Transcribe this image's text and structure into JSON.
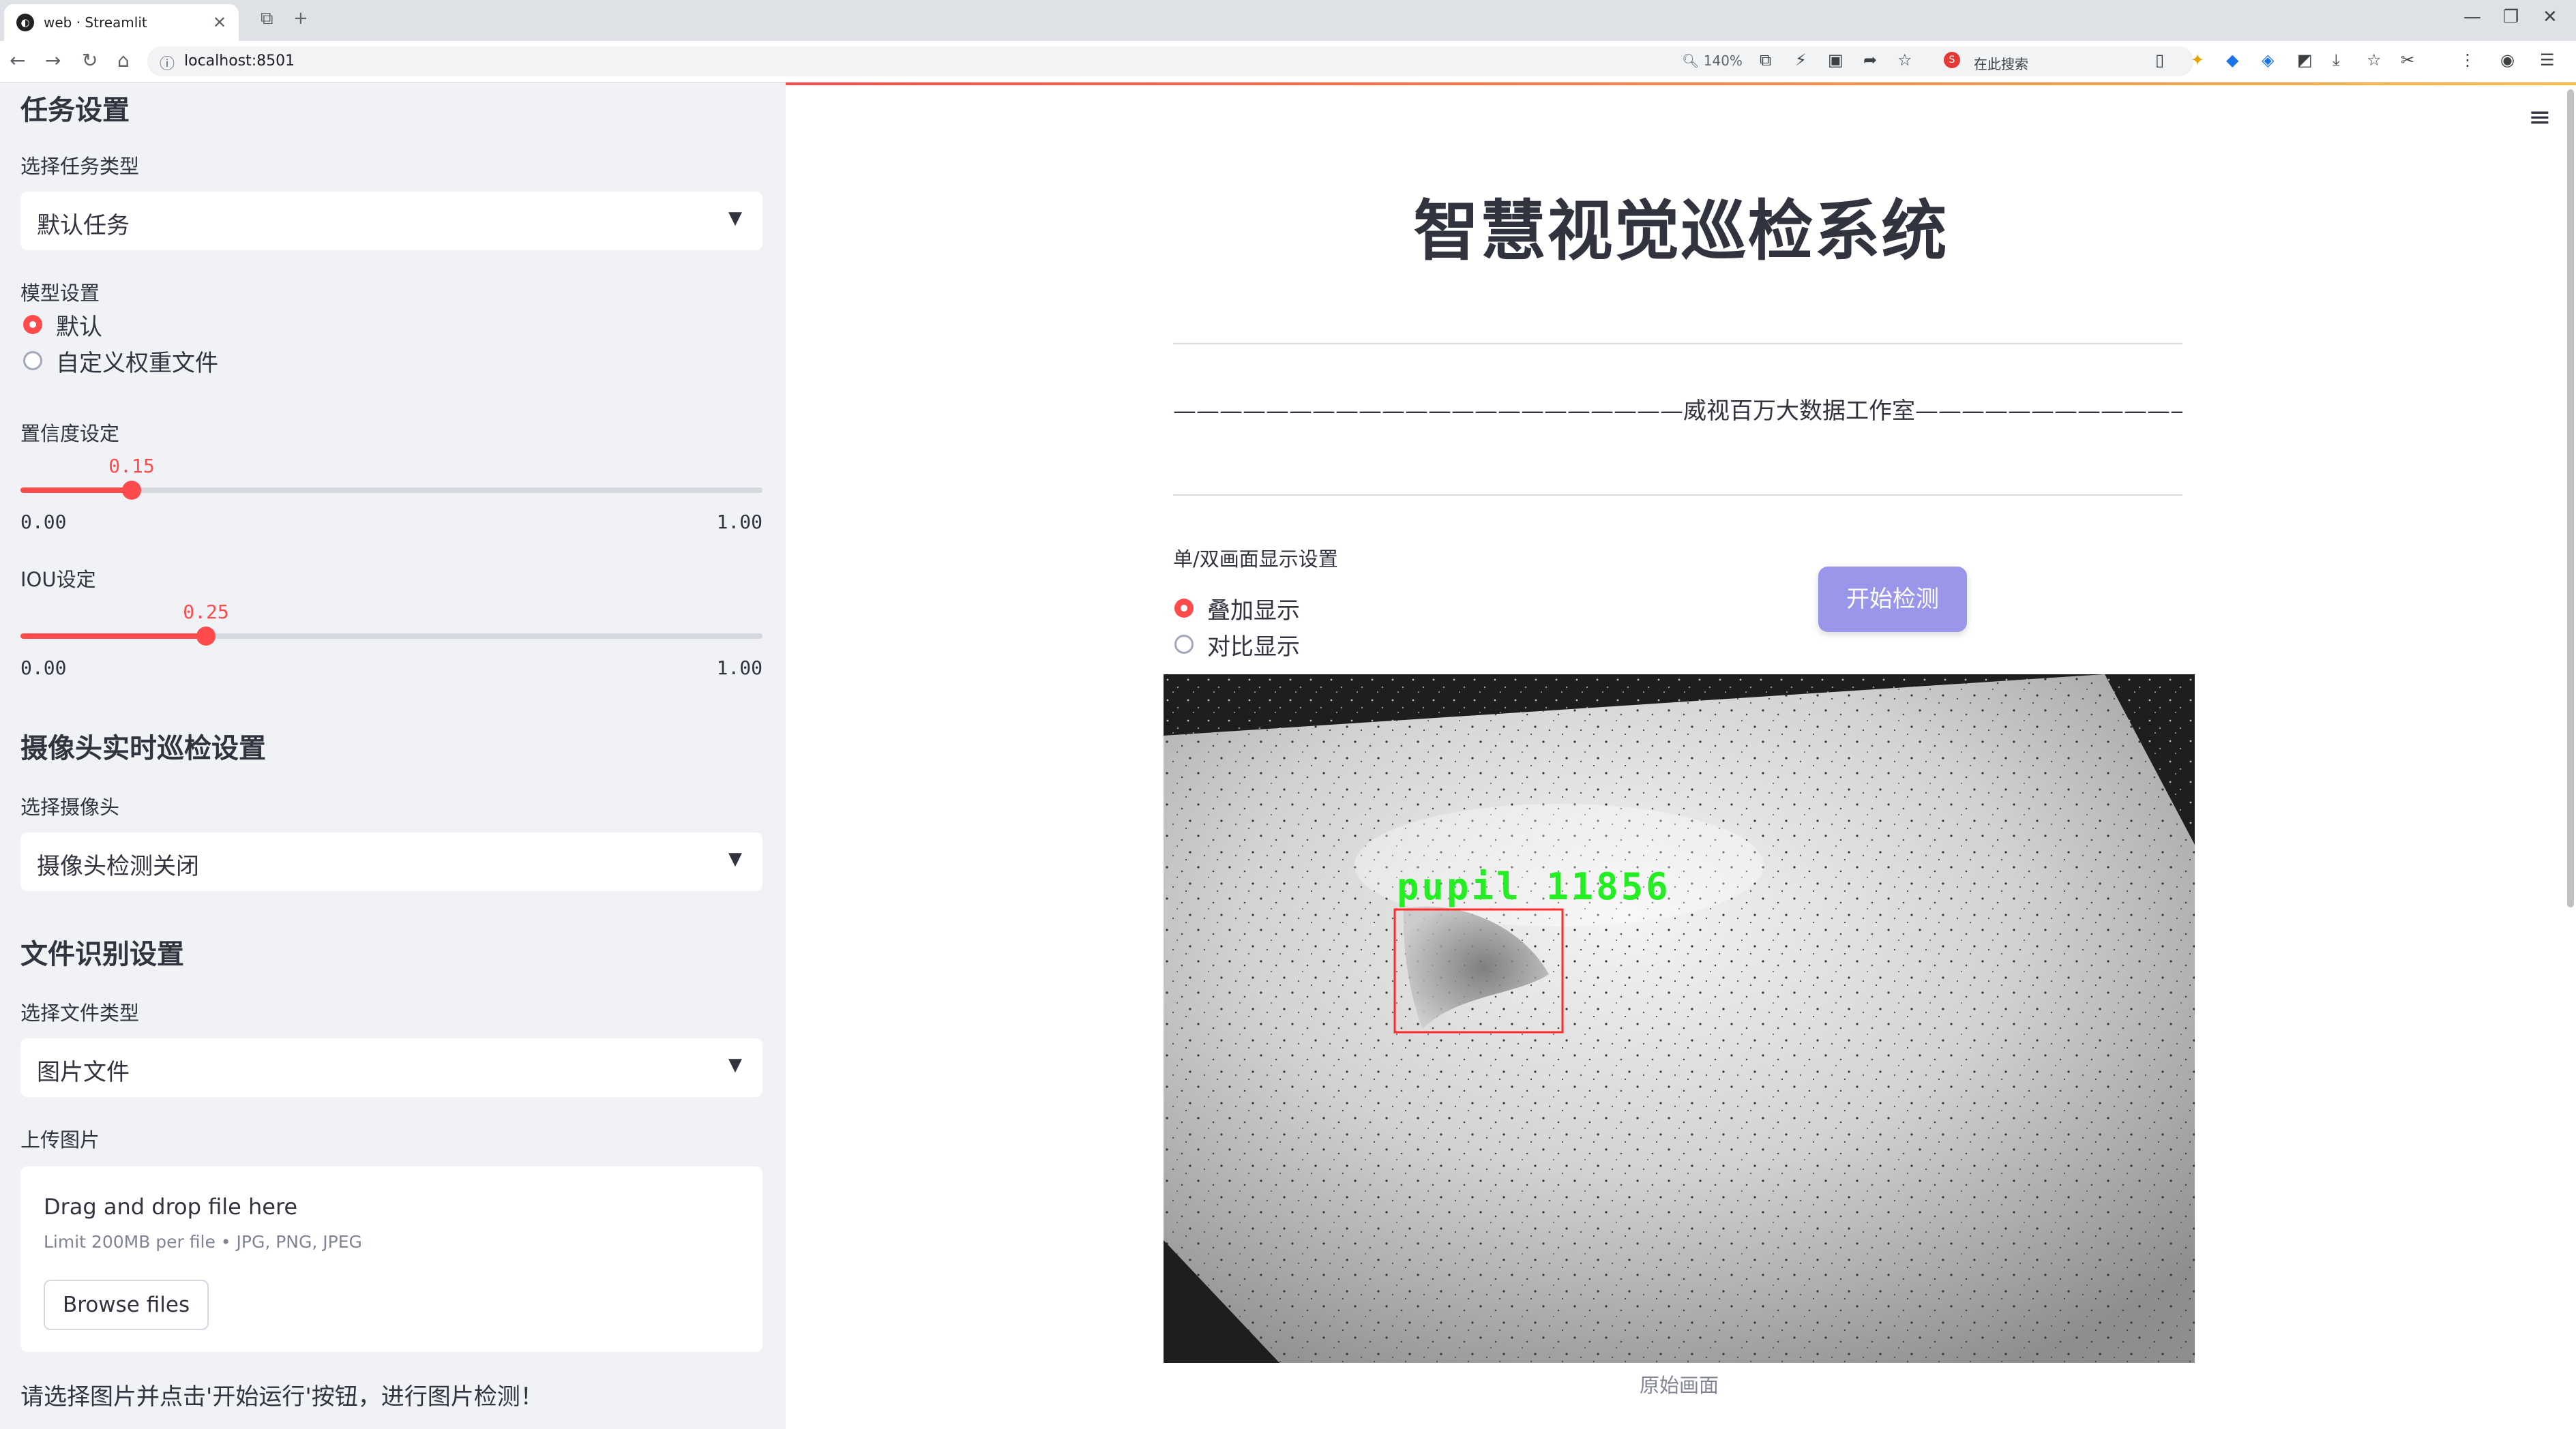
{
  "browser": {
    "tab_title": "web · Streamlit",
    "favicon_glyph": "◐",
    "url": "localhost:8501",
    "zoom": "140%",
    "search_placeholder": "在此搜索",
    "search_engine_glyph": "S"
  },
  "sidebar": {
    "task_section": {
      "heading": "任务设置",
      "task_type_label": "选择任务类型",
      "task_type_value": "默认任务"
    },
    "model": {
      "label": "模型设置",
      "options": [
        "默认",
        "自定义权重文件"
      ],
      "selected_index": 0
    },
    "confidence": {
      "label": "置信度设定",
      "value": 0.15,
      "value_text": "0.15",
      "min": "0.00",
      "max": "1.00"
    },
    "iou": {
      "label": "IOU设定",
      "value": 0.25,
      "value_text": "0.25",
      "min": "0.00",
      "max": "1.00"
    },
    "camera_section": {
      "heading": "摄像头实时巡检设置",
      "select_label": "选择摄像头",
      "select_value": "摄像头检测关闭"
    },
    "file_section": {
      "heading": "文件识别设置",
      "file_type_label": "选择文件类型",
      "file_type_value": "图片文件",
      "upload_label": "上传图片",
      "dropzone_text": "Drag and drop file here",
      "limit_text": "Limit 200MB per file • JPG, PNG, JPEG",
      "browse_label": "Browse files"
    },
    "hint": "请选择图片并点击'开始运行'按钮，进行图片检测！"
  },
  "main": {
    "title": "智慧视觉巡检系统",
    "studio_line": "——————————————————————威视百万大数据工作室———————————————————————",
    "display_mode": {
      "label": "单/双画面显示设置",
      "options": [
        "叠加显示",
        "对比显示"
      ],
      "selected_index": 0
    },
    "start_button": "开始检测",
    "image_caption": "原始画面",
    "detection": {
      "label": "pupil  11856",
      "box_color": "#ff2a2a",
      "label_color": "#22ee22"
    }
  },
  "colors": {
    "accent": "#ff4b4b",
    "button": "#9a97ea",
    "sidebar_bg": "#f0f2f6"
  }
}
